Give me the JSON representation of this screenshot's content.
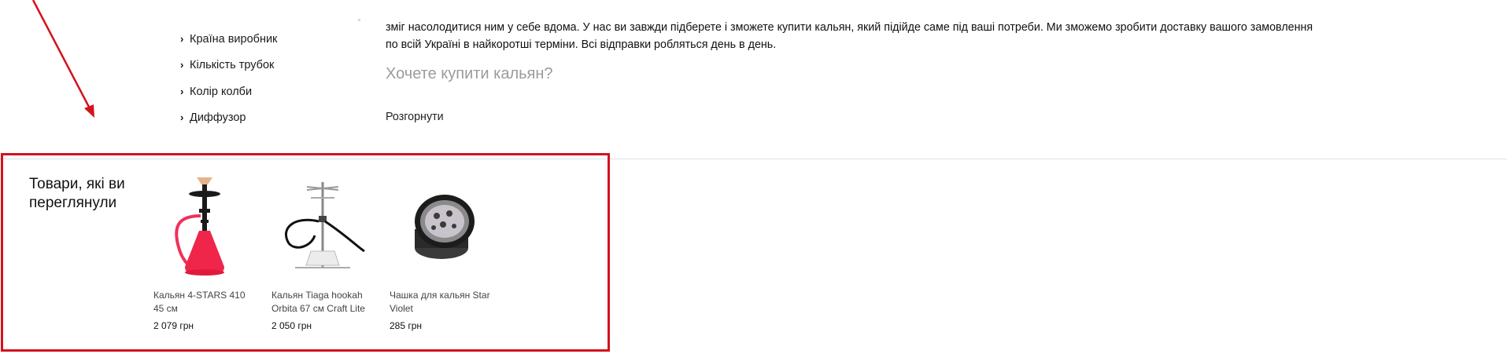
{
  "filters": [
    {
      "label": "Країна виробник"
    },
    {
      "label": "Кількість трубок"
    },
    {
      "label": "Колір колби"
    },
    {
      "label": "Диффузор"
    }
  ],
  "description": {
    "line1": "зміг насолодитися ним у себе вдома. У нас ви завжди підберете і зможете купити кальян, який підійде саме під ваші потреби. Ми зможемо зробити доставку вашого замовлення",
    "line2": "по всій Україні в найкоротші терміни. Всі відправки робляться день в день.",
    "heading": "Хочете купити кальян?",
    "expand_label": "Розгорнути"
  },
  "viewed": {
    "title": "Товари, які ви переглянули",
    "products": [
      {
        "name": "Кальян 4-STARS 410 45 см",
        "price": "2 079 грн",
        "image": "red-hookah"
      },
      {
        "name": "Кальян Tiaga hookah Orbita 67 см Craft Lite",
        "price": "2 050 грн",
        "image": "steel-hookah"
      },
      {
        "name": "Чашка для кальян Star Violet",
        "price": "285 грн",
        "image": "hookah-bowl"
      }
    ]
  },
  "colors": {
    "annotation": "#d3121c",
    "divider": "#e0e0e0",
    "heading_gray": "#9b9b9b"
  }
}
